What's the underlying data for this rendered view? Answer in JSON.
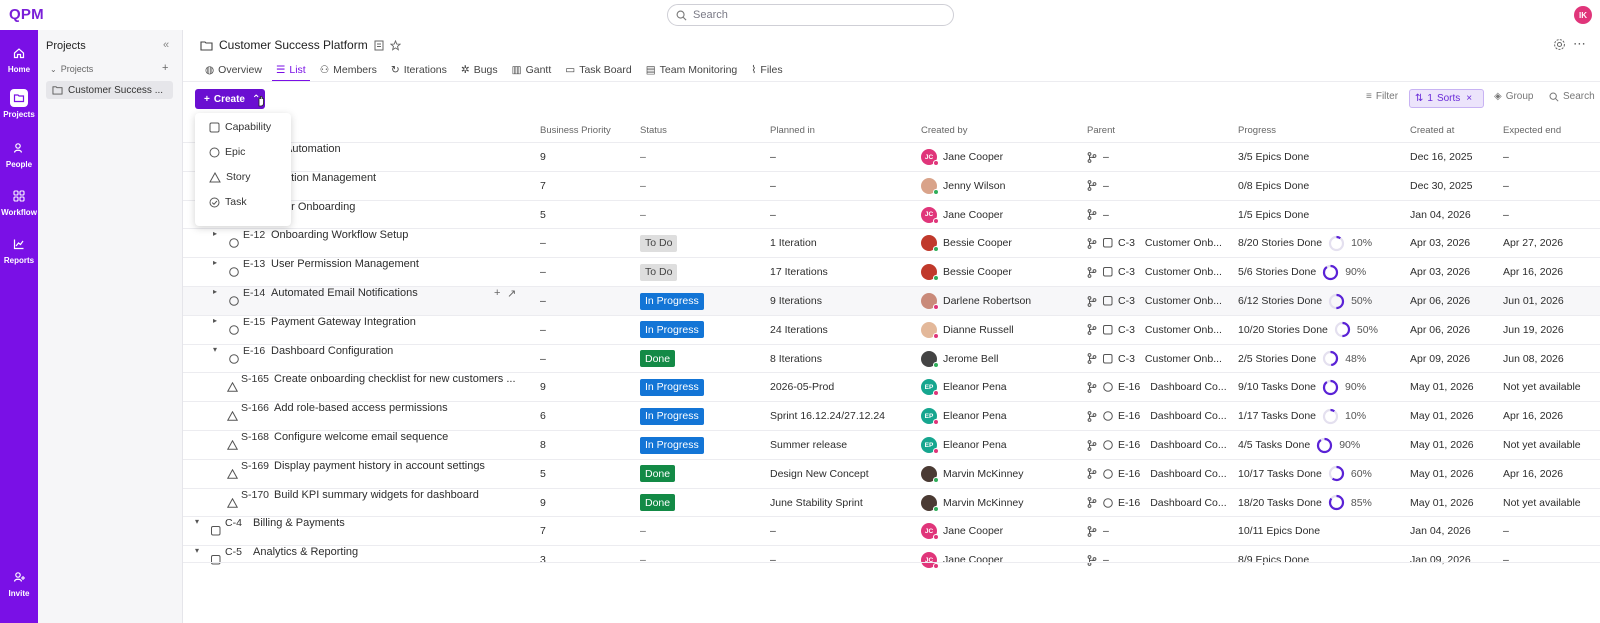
{
  "app": {
    "logo": "QPM",
    "search_placeholder": "Search",
    "user_initials": "IK"
  },
  "rail": [
    {
      "label": "Home",
      "icon": "home-icon"
    },
    {
      "label": "Projects",
      "icon": "folder-icon"
    },
    {
      "label": "People",
      "icon": "people-icon"
    },
    {
      "label": "Workflow",
      "icon": "workflow-icon"
    },
    {
      "label": "Reports",
      "icon": "reports-icon"
    },
    {
      "label": "Invite",
      "icon": "invite-icon"
    }
  ],
  "panel": {
    "title": "Projects",
    "section": "Projects",
    "project": "Customer Success ..."
  },
  "header": {
    "title": "Customer Success Platform"
  },
  "tabs": [
    "Overview",
    "List",
    "Members",
    "Iterations",
    "Bugs",
    "Gantt",
    "Task Board",
    "Team Monitoring",
    "Files"
  ],
  "toolbar": {
    "create": "Create",
    "filter": "Filter",
    "sort_count": "1",
    "sorts": "Sorts",
    "group": "Group",
    "search": "Search"
  },
  "dropdown": [
    "Capability",
    "Epic",
    "Story",
    "Task"
  ],
  "columns": [
    "Business Priority",
    "Status",
    "Planned in",
    "Created by",
    "Parent",
    "Progress",
    "Created at",
    "Expected end"
  ],
  "rows": [
    {
      "key": "",
      "title": "Automation",
      "priority": "9",
      "status": "–",
      "planned": "–",
      "creator": "Jane Cooper",
      "parent_key": "",
      "parent_title": "–",
      "progress": "3/5 Epics Done",
      "pct": "",
      "created": "Dec 16, 2025",
      "end": "–"
    },
    {
      "key": "",
      "title": "otion Management",
      "priority": "7",
      "status": "–",
      "planned": "–",
      "creator": "Jenny Wilson",
      "parent_key": "",
      "parent_title": "–",
      "progress": "0/8 Epics Done",
      "pct": "",
      "created": "Dec 30, 2025",
      "end": "–"
    },
    {
      "key": "",
      "title": "er Onboarding",
      "priority": "5",
      "status": "–",
      "planned": "–",
      "creator": "Jane Cooper",
      "parent_key": "",
      "parent_title": "–",
      "progress": "1/5 Epics Done",
      "pct": "",
      "created": "Jan 04, 2026",
      "end": "–"
    },
    {
      "key": "E-12",
      "title": "Onboarding Workflow Setup",
      "priority": "–",
      "status": "To Do",
      "planned": "1 Iteration",
      "creator": "Bessie Cooper",
      "parent_key": "C-3",
      "parent_title": "Customer Onb...",
      "progress": "8/20 Stories Done",
      "pct": "10%",
      "created": "Apr 03, 2026",
      "end": "Apr 27, 2026"
    },
    {
      "key": "E-13",
      "title": "User Permission Management",
      "priority": "–",
      "status": "To Do",
      "planned": "17 Iterations",
      "creator": "Bessie Cooper",
      "parent_key": "C-3",
      "parent_title": "Customer Onb...",
      "progress": "5/6 Stories Done",
      "pct": "90%",
      "created": "Apr 03, 2026",
      "end": "Apr 16, 2026"
    },
    {
      "key": "E-14",
      "title": "Automated Email Notifications",
      "priority": "–",
      "status": "In Progress",
      "planned": "9 Iterations",
      "creator": "Darlene Robertson",
      "parent_key": "C-3",
      "parent_title": "Customer Onb...",
      "progress": "6/12 Stories Done",
      "pct": "50%",
      "created": "Apr 06, 2026",
      "end": "Jun 01, 2026"
    },
    {
      "key": "E-15",
      "title": "Payment Gateway Integration",
      "priority": "–",
      "status": "In Progress",
      "planned": "24 Iterations",
      "creator": "Dianne Russell",
      "parent_key": "C-3",
      "parent_title": "Customer Onb...",
      "progress": "10/20 Stories Done",
      "pct": "50%",
      "created": "Apr 06, 2026",
      "end": "Jun 19, 2026"
    },
    {
      "key": "E-16",
      "title": "Dashboard Configuration",
      "priority": "–",
      "status": "Done",
      "planned": "8 Iterations",
      "creator": "Jerome Bell",
      "parent_key": "C-3",
      "parent_title": "Customer Onb...",
      "progress": "2/5 Stories Done",
      "pct": "48%",
      "created": "Apr 09, 2026",
      "end": "Jun 08, 2026"
    },
    {
      "key": "S-165",
      "title": "Create onboarding checklist for new customers ...",
      "priority": "9",
      "status": "In Progress",
      "planned": "2026-05-Prod",
      "creator": "Eleanor Pena",
      "parent_key": "E-16",
      "parent_title": "Dashboard Co...",
      "progress": "9/10 Tasks Done",
      "pct": "90%",
      "created": "May 01, 2026",
      "end": "Not yet available"
    },
    {
      "key": "S-166",
      "title": "Add role-based access permissions",
      "priority": "6",
      "status": "In Progress",
      "planned": "Sprint 16.12.24/27.12.24",
      "creator": "Eleanor Pena",
      "parent_key": "E-16",
      "parent_title": "Dashboard Co...",
      "progress": "1/17 Tasks Done",
      "pct": "10%",
      "created": "May 01, 2026",
      "end": "Apr 16, 2026"
    },
    {
      "key": "S-168",
      "title": "Configure welcome email sequence",
      "priority": "8",
      "status": "In Progress",
      "planned": "Summer release",
      "creator": "Eleanor Pena",
      "parent_key": "E-16",
      "parent_title": "Dashboard Co...",
      "progress": "4/5 Tasks Done",
      "pct": "90%",
      "created": "May 01, 2026",
      "end": "Not yet available"
    },
    {
      "key": "S-169",
      "title": "Display payment history in account settings",
      "priority": "5",
      "status": "Done",
      "planned": "Design New Concept",
      "creator": "Marvin McKinney",
      "parent_key": "E-16",
      "parent_title": "Dashboard Co...",
      "progress": "10/17 Tasks Done",
      "pct": "60%",
      "created": "May 01, 2026",
      "end": "Apr 16, 2026"
    },
    {
      "key": "S-170",
      "title": "Build KPI summary widgets for dashboard",
      "priority": "9",
      "status": "Done",
      "planned": "June Stability Sprint",
      "creator": "Marvin McKinney",
      "parent_key": "E-16",
      "parent_title": "Dashboard Co...",
      "progress": "18/20 Tasks Done",
      "pct": "85%",
      "created": "May 01, 2026",
      "end": "Not yet available"
    },
    {
      "key": "C-4",
      "title": "Billing & Payments",
      "priority": "7",
      "status": "–",
      "planned": "–",
      "creator": "Jane Cooper",
      "parent_key": "",
      "parent_title": "–",
      "progress": "10/11 Epics Done",
      "pct": "",
      "created": "Jan 04, 2026",
      "end": "–"
    },
    {
      "key": "C-5",
      "title": "Analytics & Reporting",
      "priority": "3",
      "status": "–",
      "planned": "–",
      "creator": "Jane Cooper",
      "parent_key": "",
      "parent_title": "–",
      "progress": "8/9 Epics Done",
      "pct": "",
      "created": "Jan 09, 2026",
      "end": "–"
    }
  ],
  "initials": {
    "jane": "JC",
    "eleanor": "EP"
  },
  "colors": {
    "brand": "#7a10e6",
    "in_progress": "#1375d6",
    "done": "#138a46",
    "todo": "#dedede"
  }
}
